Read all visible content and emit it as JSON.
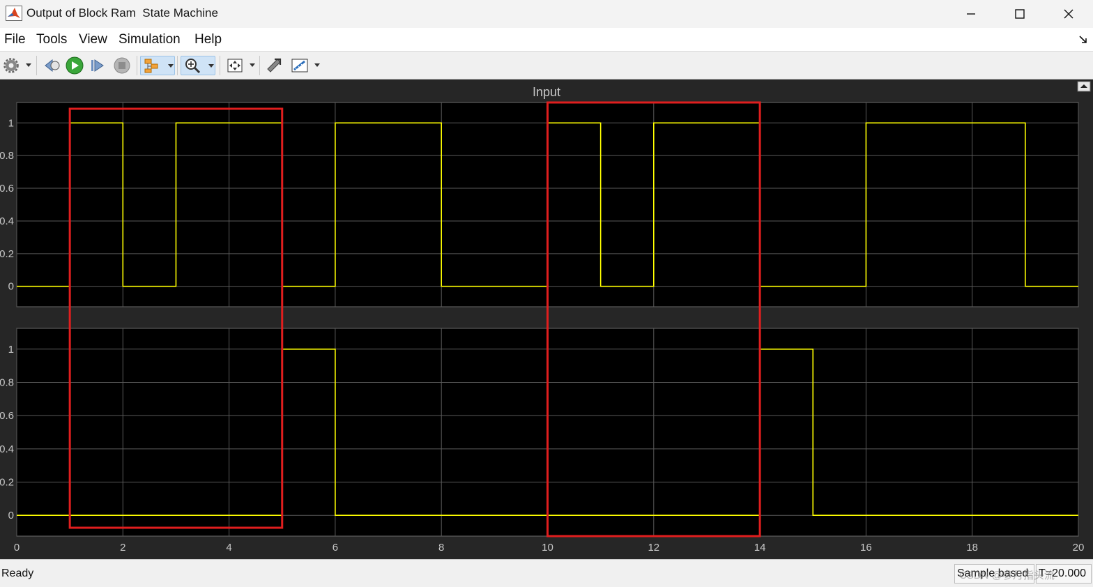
{
  "window": {
    "title": "Output of Block Ram  State Machine",
    "icon": "matlab-icon"
  },
  "menu": [
    "File",
    "Tools",
    "View",
    "Simulation",
    "Help"
  ],
  "toolbar": [
    "settings-icon",
    "step-back-icon",
    "run-icon",
    "step-forward-icon",
    "stop-icon",
    "highlight-block-icon",
    "zoom-icon",
    "scale-axes-icon",
    "restore-icon",
    "measurements-icon"
  ],
  "scope": {
    "title": "Input",
    "colors": {
      "background": "#262626",
      "axes": "#000000",
      "grid": "#5a5a5a",
      "signal": "#ffff00",
      "text": "#c8c8c8",
      "highlight": "#e01e1e"
    }
  },
  "chart_data": [
    {
      "type": "line",
      "title": "Input",
      "xlim": [
        0,
        20
      ],
      "ylim": [
        -0.125,
        1.125
      ],
      "yticks": [
        0,
        0.2,
        0.4,
        0.6,
        0.8,
        1
      ],
      "xticks": [
        0,
        2,
        4,
        6,
        8,
        10,
        12,
        14,
        16,
        18,
        20
      ],
      "step": true,
      "series": [
        {
          "x": [
            0,
            1,
            2,
            3,
            5,
            6,
            8,
            10,
            11,
            12,
            14,
            16,
            19,
            20
          ],
          "y": [
            0,
            1,
            0,
            1,
            0,
            1,
            0,
            1,
            0,
            1,
            0,
            1,
            0,
            0
          ]
        }
      ],
      "highlights": [
        [
          1,
          5
        ],
        [
          10,
          14
        ]
      ]
    },
    {
      "type": "line",
      "xlim": [
        0,
        20
      ],
      "ylim": [
        -0.125,
        1.125
      ],
      "yticks": [
        0,
        0.2,
        0.4,
        0.6,
        0.8,
        1
      ],
      "xticks": [
        0,
        2,
        4,
        6,
        8,
        10,
        12,
        14,
        16,
        18,
        20
      ],
      "xticklabels": [
        "0",
        "2",
        "4",
        "6",
        "8",
        "10",
        "12",
        "14",
        "16",
        "18",
        "20"
      ],
      "step": true,
      "series": [
        {
          "x": [
            0,
            5,
            6,
            14,
            15,
            20
          ],
          "y": [
            0,
            1,
            0,
            1,
            0,
            0
          ]
        }
      ]
    }
  ],
  "status": {
    "ready": "Ready",
    "sample": "Sample based",
    "time": "T=20.000",
    "watermark": "CSDN @参月指头流"
  }
}
